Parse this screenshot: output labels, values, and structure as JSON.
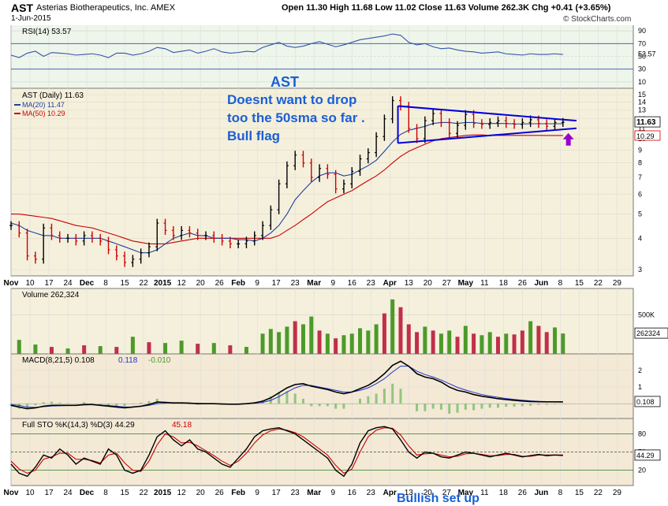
{
  "header": {
    "ticker": "AST",
    "company": "Asterias Biotherapeutics, Inc. AMEX",
    "date": "1-Jun-2015",
    "ohlc": "Open 11.30  High 11.68  Low 11.02  Close 11.63  Volume 262.3K  Chg +0.41 (+3.65%)",
    "brand": "© StockCharts.com"
  },
  "annotation": {
    "line1": "AST",
    "line2": "Doesnt want to drop",
    "line3": "too the 50sma so far .",
    "line4": "Bull flag",
    "footer": "Bullish set up"
  },
  "colors": {
    "price_up": "#000000",
    "price_down": "#cc0000",
    "ma20": "#1f3f9f",
    "ma50": "#cc0000",
    "rsi": "#3355aa",
    "macd": "#000000",
    "signal": "#2233cc",
    "sto_k": "#000000",
    "sto_d": "#cc0000",
    "trendline": "#0000dd",
    "arrow": "#9900cc",
    "panel_bg": "#f4ede0"
  },
  "chart_data": [
    {
      "type": "line",
      "panel": "rsi",
      "legend": "RSI(14) 53.57",
      "ylim": [
        0,
        100
      ],
      "yticks": [
        10,
        30,
        50,
        70,
        90
      ],
      "last_label": "53.57",
      "x_days": [
        0,
        3,
        6,
        9,
        12,
        15,
        18,
        21,
        24,
        27,
        30,
        33,
        36,
        39,
        42,
        45,
        48,
        51,
        54,
        57,
        60,
        63,
        66,
        69,
        72,
        75,
        78,
        81,
        84,
        87,
        90,
        93,
        96,
        99,
        102,
        105,
        108,
        111,
        114,
        117,
        120,
        123,
        126,
        129,
        132,
        135,
        138,
        141,
        144,
        147,
        150,
        153,
        156,
        159,
        162,
        165,
        168,
        171,
        174,
        177,
        180,
        183,
        186,
        189,
        192,
        195,
        198,
        201,
        204
      ],
      "values": [
        52,
        48,
        55,
        58,
        50,
        56,
        55,
        54,
        52,
        53,
        54,
        52,
        48,
        55,
        55,
        52,
        54,
        58,
        64,
        62,
        56,
        58,
        60,
        55,
        58,
        62,
        57,
        55,
        56,
        58,
        57,
        64,
        68,
        72,
        66,
        64,
        66,
        70,
        73,
        69,
        65,
        68,
        72,
        76,
        78,
        80,
        82,
        85,
        83,
        72,
        68,
        70,
        65,
        62,
        63,
        60,
        58,
        57,
        55,
        56,
        57,
        54,
        53,
        52,
        54,
        53,
        53,
        54,
        53
      ]
    },
    {
      "type": "ohlc",
      "panel": "price",
      "legend": [
        "AST (Daily) 11.63",
        "MA(20) 11.47",
        "MA(50) 10.29"
      ],
      "ylim": [
        3,
        15
      ],
      "log_scale": true,
      "yticks": [
        3,
        4,
        5,
        6,
        7,
        8,
        9,
        10,
        11,
        12,
        13,
        14,
        15
      ],
      "last_labels": [
        "11.63",
        "10.29"
      ],
      "x_axis_labels": [
        "Nov",
        "10",
        "17",
        "24",
        "Dec",
        "8",
        "15",
        "22",
        "2015",
        "12",
        "20",
        "26",
        "Feb",
        "9",
        "17",
        "23",
        "Mar",
        "9",
        "16",
        "23",
        "Apr",
        "13",
        "20",
        "27",
        "May",
        "11",
        "18",
        "26",
        "Jun",
        "8",
        "15",
        "22",
        "29"
      ],
      "close_days": [
        0,
        3,
        6,
        9,
        12,
        15,
        18,
        21,
        24,
        27,
        30,
        33,
        36,
        39,
        42,
        45,
        48,
        51,
        54,
        57,
        60,
        63,
        66,
        69,
        72,
        75,
        78,
        81,
        84,
        87,
        90,
        93,
        96,
        99,
        102,
        105,
        108,
        111,
        114,
        117,
        120,
        123,
        126,
        129,
        132,
        135,
        138,
        141,
        144,
        147,
        150,
        153,
        156,
        159,
        162,
        165,
        168,
        171,
        174,
        177,
        180,
        183,
        186,
        189,
        192,
        195,
        198,
        201,
        204
      ],
      "close": [
        4.5,
        4.2,
        3.4,
        3.3,
        4.4,
        4.1,
        4.0,
        4.0,
        3.9,
        4.1,
        4.0,
        3.9,
        3.6,
        3.4,
        3.2,
        3.3,
        3.5,
        3.7,
        4.6,
        4.3,
        4.1,
        4.3,
        4.2,
        4.1,
        4.1,
        4.0,
        3.9,
        3.8,
        3.8,
        3.9,
        4.1,
        4.5,
        5.2,
        6.6,
        7.8,
        8.6,
        8.0,
        7.0,
        7.6,
        7.2,
        6.3,
        6.6,
        7.4,
        8.3,
        8.8,
        10.2,
        12.0,
        14.2,
        13.5,
        11.0,
        10.0,
        11.8,
        12.6,
        11.6,
        10.5,
        11.3,
        12.5,
        11.5,
        11.4,
        11.6,
        11.8,
        11.5,
        11.4,
        11.6,
        11.9,
        11.5,
        11.2,
        11.6,
        11.63
      ],
      "ma20": [
        4.6,
        4.5,
        4.3,
        4.2,
        4.1,
        4.1,
        4.0,
        4.0,
        4.0,
        4.0,
        4.0,
        4.0,
        3.9,
        3.8,
        3.7,
        3.6,
        3.5,
        3.5,
        3.6,
        3.8,
        4.0,
        4.1,
        4.2,
        4.1,
        4.1,
        4.0,
        4.0,
        4.0,
        3.95,
        3.95,
        3.9,
        4.0,
        4.2,
        4.5,
        5.0,
        5.7,
        6.2,
        6.7,
        7.1,
        7.3,
        7.3,
        7.1,
        7.2,
        7.5,
        7.8,
        8.2,
        8.9,
        9.7,
        10.4,
        10.8,
        11.0,
        11.2,
        11.5,
        11.6,
        11.6,
        11.5,
        11.6,
        11.6,
        11.5,
        11.5,
        11.5,
        11.5,
        11.45,
        11.45,
        11.47,
        11.47,
        11.47,
        11.47,
        11.47
      ],
      "ma50": [
        5.0,
        5.0,
        4.95,
        4.9,
        4.85,
        4.8,
        4.7,
        4.6,
        4.5,
        4.45,
        4.4,
        4.3,
        4.2,
        4.1,
        4.0,
        3.9,
        3.85,
        3.8,
        3.8,
        3.8,
        3.85,
        3.9,
        3.95,
        4.0,
        4.0,
        4.0,
        4.0,
        4.0,
        4.0,
        4.0,
        4.0,
        4.0,
        4.0,
        4.1,
        4.3,
        4.5,
        4.75,
        5.0,
        5.3,
        5.6,
        5.8,
        6.0,
        6.2,
        6.5,
        6.8,
        7.1,
        7.5,
        8.0,
        8.5,
        8.9,
        9.2,
        9.5,
        9.8,
        10.0,
        10.1,
        10.2,
        10.3,
        10.35,
        10.35,
        10.3,
        10.3,
        10.3,
        10.3,
        10.3,
        10.3,
        10.3,
        10.29,
        10.29,
        10.29
      ],
      "triangle_upper": [
        [
          143,
          13.5
        ],
        [
          209,
          11.8
        ]
      ],
      "triangle_lower": [
        [
          143,
          9.6
        ],
        [
          209,
          11.0
        ]
      ],
      "arrow_at": [
        206,
        9.8
      ]
    },
    {
      "type": "bar",
      "panel": "volume",
      "legend": "Volume 262,324",
      "ylim": [
        0,
        800
      ],
      "yticks_labels": [
        "500K"
      ],
      "last_label": "262324",
      "x_days": [
        3,
        9,
        15,
        21,
        27,
        33,
        39,
        45,
        51,
        57,
        63,
        69,
        75,
        81,
        87,
        93,
        96,
        99,
        102,
        105,
        108,
        111,
        114,
        117,
        120,
        123,
        126,
        129,
        132,
        135,
        138,
        141,
        144,
        147,
        150,
        153,
        156,
        159,
        162,
        165,
        168,
        171,
        174,
        177,
        180,
        183,
        186,
        189,
        192,
        195,
        198,
        201,
        204
      ],
      "values": [
        180,
        120,
        90,
        70,
        110,
        100,
        90,
        220,
        150,
        140,
        170,
        130,
        140,
        110,
        90,
        260,
        320,
        280,
        350,
        420,
        380,
        480,
        300,
        260,
        200,
        240,
        260,
        330,
        300,
        380,
        520,
        700,
        600,
        380,
        280,
        350,
        300,
        260,
        300,
        220,
        360,
        260,
        240,
        280,
        220,
        260,
        250,
        300,
        420,
        360,
        280,
        340,
        262
      ],
      "up_flags": [
        1,
        1,
        0,
        1,
        0,
        1,
        0,
        1,
        0,
        1,
        1,
        0,
        1,
        0,
        1,
        1,
        1,
        1,
        1,
        0,
        1,
        1,
        0,
        1,
        0,
        1,
        1,
        1,
        1,
        1,
        0,
        1,
        0,
        0,
        0,
        1,
        0,
        1,
        1,
        0,
        1,
        0,
        1,
        1,
        0,
        1,
        0,
        0,
        1,
        0,
        0,
        1,
        1
      ]
    },
    {
      "type": "line",
      "panel": "macd",
      "legend": [
        "MACD(8,21,5) 0.108",
        "0.118",
        "-0.010"
      ],
      "ylim": [
        -0.7,
        2.8
      ],
      "yticks": [
        1,
        2
      ],
      "last_label": "0.108",
      "x_days": [
        0,
        3,
        6,
        9,
        12,
        15,
        18,
        21,
        24,
        27,
        30,
        33,
        36,
        39,
        42,
        45,
        48,
        51,
        54,
        57,
        60,
        63,
        66,
        69,
        72,
        75,
        78,
        81,
        84,
        87,
        90,
        93,
        96,
        99,
        102,
        105,
        108,
        111,
        114,
        117,
        120,
        123,
        126,
        129,
        132,
        135,
        138,
        141,
        144,
        147,
        150,
        153,
        156,
        159,
        162,
        165,
        168,
        171,
        174,
        177,
        180,
        183,
        186,
        189,
        192,
        195,
        198,
        201,
        204
      ],
      "macd": [
        -0.1,
        -0.2,
        -0.3,
        -0.25,
        -0.15,
        -0.1,
        -0.1,
        -0.1,
        -0.1,
        -0.05,
        -0.05,
        -0.1,
        -0.15,
        -0.2,
        -0.25,
        -0.2,
        -0.15,
        -0.05,
        0.1,
        0.08,
        0.05,
        0.05,
        0.03,
        0.0,
        0.0,
        0.0,
        -0.02,
        -0.03,
        -0.03,
        0.0,
        0.05,
        0.15,
        0.35,
        0.65,
        0.95,
        1.15,
        1.2,
        1.05,
        0.95,
        0.85,
        0.7,
        0.6,
        0.7,
        0.9,
        1.1,
        1.4,
        1.8,
        2.3,
        2.55,
        2.25,
        1.8,
        1.6,
        1.5,
        1.3,
        1.0,
        0.8,
        0.7,
        0.55,
        0.45,
        0.38,
        0.3,
        0.25,
        0.2,
        0.16,
        0.13,
        0.12,
        0.11,
        0.11,
        0.108
      ],
      "signal": [
        -0.05,
        -0.1,
        -0.2,
        -0.22,
        -0.18,
        -0.14,
        -0.12,
        -0.11,
        -0.1,
        -0.08,
        -0.06,
        -0.08,
        -0.1,
        -0.15,
        -0.2,
        -0.2,
        -0.17,
        -0.1,
        0.0,
        0.04,
        0.05,
        0.05,
        0.04,
        0.02,
        0.01,
        0.0,
        0.0,
        -0.02,
        -0.02,
        -0.01,
        0.02,
        0.08,
        0.2,
        0.42,
        0.7,
        0.95,
        1.1,
        1.1,
        1.0,
        0.9,
        0.8,
        0.7,
        0.7,
        0.8,
        0.95,
        1.2,
        1.5,
        1.9,
        2.25,
        2.25,
        1.95,
        1.75,
        1.6,
        1.42,
        1.2,
        0.98,
        0.82,
        0.68,
        0.55,
        0.46,
        0.38,
        0.31,
        0.26,
        0.21,
        0.17,
        0.14,
        0.13,
        0.12,
        0.118
      ]
    },
    {
      "type": "line",
      "panel": "stochastic",
      "legend": [
        "Full STO %K(14,3) %D(3) 44.29",
        "45.18"
      ],
      "ylim": [
        0,
        100
      ],
      "yticks": [
        20,
        50,
        80
      ],
      "last_label": "44.29",
      "x_days": [
        0,
        3,
        6,
        9,
        12,
        15,
        18,
        21,
        24,
        27,
        30,
        33,
        36,
        39,
        42,
        45,
        48,
        51,
        54,
        57,
        60,
        63,
        66,
        69,
        72,
        75,
        78,
        81,
        84,
        87,
        90,
        93,
        96,
        99,
        102,
        105,
        108,
        111,
        114,
        117,
        120,
        123,
        126,
        129,
        132,
        135,
        138,
        141,
        144,
        147,
        150,
        153,
        156,
        159,
        162,
        165,
        168,
        171,
        174,
        177,
        180,
        183,
        186,
        189,
        192,
        195,
        198,
        201,
        204
      ],
      "k": [
        30,
        15,
        10,
        25,
        45,
        40,
        55,
        45,
        30,
        40,
        35,
        30,
        55,
        45,
        20,
        15,
        20,
        45,
        75,
        85,
        70,
        60,
        70,
        55,
        50,
        40,
        30,
        25,
        40,
        55,
        75,
        85,
        88,
        90,
        85,
        80,
        70,
        60,
        50,
        40,
        20,
        10,
        30,
        65,
        85,
        90,
        92,
        88,
        70,
        50,
        40,
        50,
        48,
        42,
        40,
        45,
        50,
        48,
        45,
        42,
        45,
        48,
        45,
        42,
        44,
        46,
        44,
        45,
        44.29
      ],
      "d": [
        35,
        22,
        15,
        20,
        38,
        42,
        48,
        48,
        38,
        38,
        36,
        32,
        45,
        48,
        32,
        20,
        18,
        35,
        62,
        80,
        75,
        65,
        66,
        60,
        52,
        44,
        35,
        28,
        35,
        48,
        65,
        78,
        85,
        88,
        86,
        82,
        75,
        65,
        55,
        45,
        28,
        15,
        22,
        50,
        75,
        86,
        90,
        89,
        78,
        60,
        45,
        47,
        48,
        45,
        42,
        43,
        47,
        48,
        46,
        44,
        44,
        46,
        46,
        43,
        43,
        45,
        45,
        45,
        45.18
      ]
    }
  ]
}
